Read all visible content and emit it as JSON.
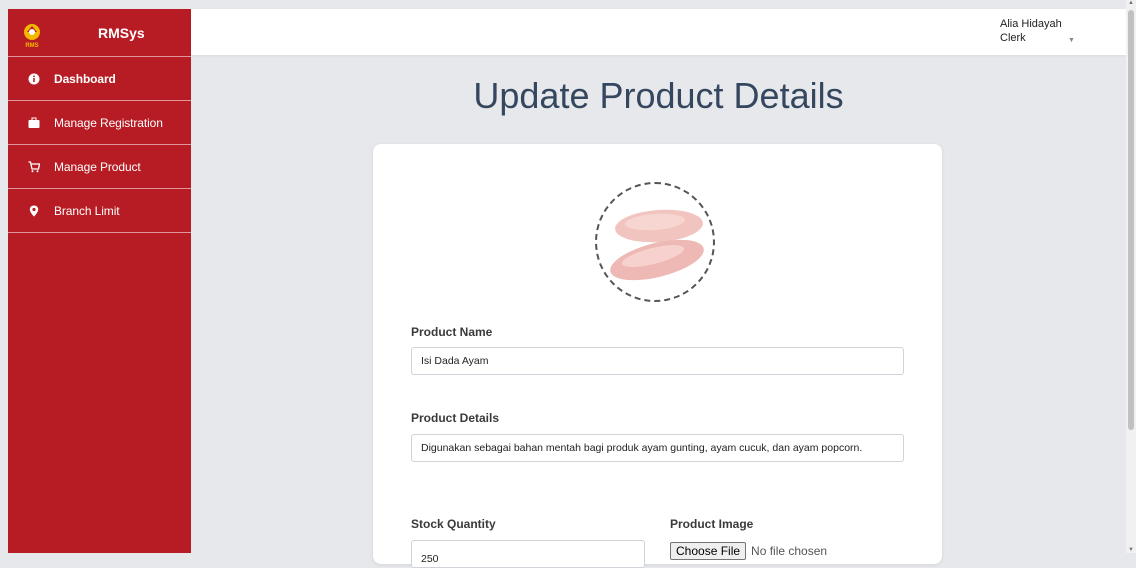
{
  "brand": {
    "name": "RMSys",
    "logo_text": "RMS"
  },
  "sidebar": {
    "items": [
      {
        "label": "Dashboard",
        "icon": "info-circle-icon"
      },
      {
        "label": "Manage Registration",
        "icon": "briefcase-icon"
      },
      {
        "label": "Manage Product",
        "icon": "cart-icon"
      },
      {
        "label": "Branch Limit",
        "icon": "map-pin-icon"
      }
    ]
  },
  "user": {
    "name": "Alia Hidayah",
    "role": "Clerk"
  },
  "page": {
    "title": "Update Product Details"
  },
  "form": {
    "product_name_label": "Product Name",
    "product_name_value": "Isi Dada Ayam",
    "product_details_label": "Product Details",
    "product_details_value": "Digunakan sebagai bahan mentah bagi produk ayam gunting, ayam cucuk, dan ayam popcorn.",
    "stock_quantity_label": "Stock Quantity",
    "stock_quantity_value": "250",
    "product_image_label": "Product Image",
    "choose_file_label": "Choose File",
    "file_status": "No file chosen"
  },
  "colors": {
    "sidebar": "#b71c24",
    "title": "#34475f"
  }
}
